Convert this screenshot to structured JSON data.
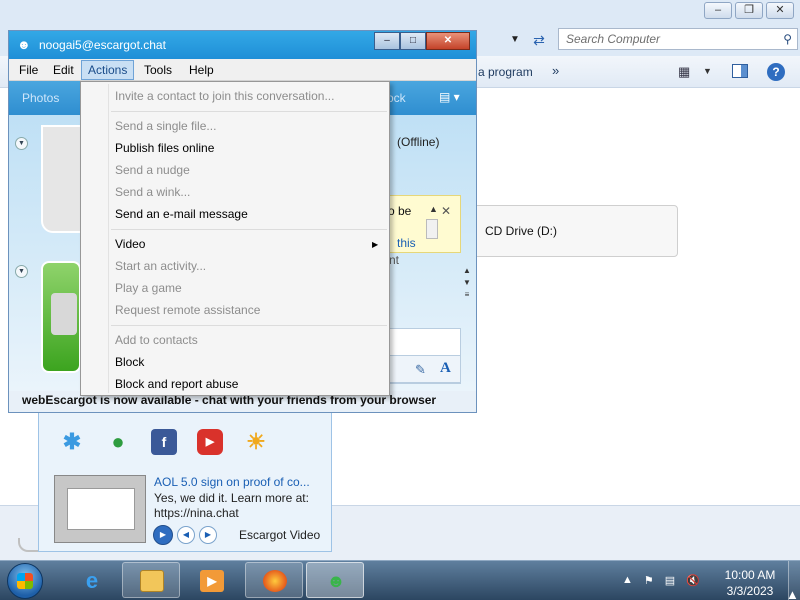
{
  "explorer": {
    "search_placeholder": "Search Computer",
    "toolbar_program": "a program",
    "toolbar_more": "»",
    "drive_label": "CD Drive (D:)"
  },
  "messenger_main": {
    "video_title": "AOL 5.0 sign on proof of co...",
    "video_desc": "Yes, we did it. Learn more at: https://nina.chat",
    "video_label": "Escargot Video"
  },
  "conversation": {
    "title": "noogai5@escargot.chat",
    "menus": [
      "File",
      "Edit",
      "Actions",
      "Tools",
      "Help"
    ],
    "toolbar_left": "Photos",
    "toolbar_right": "ock",
    "contact_status": "(Offline)",
    "notice_text": "o be",
    "notice_link": "this",
    "partial_text": "nt",
    "footer": "webEscargot is now available - chat with your friends from your browser"
  },
  "actions_menu": {
    "items": [
      {
        "label": "Invite a contact to join this conversation...",
        "enabled": false
      },
      {
        "label": "Send a single file...",
        "enabled": false
      },
      {
        "label": "Publish files online",
        "enabled": true
      },
      {
        "label": "Send a nudge",
        "enabled": false
      },
      {
        "label": "Send a wink...",
        "enabled": false
      },
      {
        "label": "Send an e-mail message",
        "enabled": true
      },
      {
        "label": "Video",
        "enabled": true,
        "submenu": true
      },
      {
        "label": "Start an activity...",
        "enabled": false
      },
      {
        "label": "Play a game",
        "enabled": false
      },
      {
        "label": "Request remote assistance",
        "enabled": false
      },
      {
        "label": "Add to contacts",
        "enabled": false
      },
      {
        "label": "Block",
        "enabled": true
      },
      {
        "label": "Block and report abuse",
        "enabled": true
      }
    ]
  },
  "taskbar": {
    "time": "10:00 AM",
    "date": "3/3/2023"
  }
}
